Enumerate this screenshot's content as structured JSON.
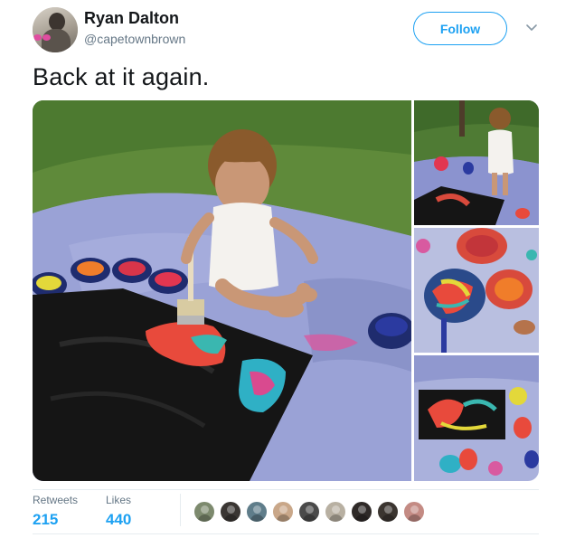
{
  "author": {
    "name": "Ryan Dalton",
    "handle": "@capetownbrown",
    "avatar_icon": "user-avatar"
  },
  "actions": {
    "follow_label": "Follow",
    "more_icon": "chevron-down-icon"
  },
  "tweet": {
    "text": "Back at it again."
  },
  "media": {
    "photo_count": 4,
    "photos": [
      "main-photo",
      "side-photo-1",
      "side-photo-2",
      "side-photo-3"
    ]
  },
  "stats": {
    "retweets_label": "Retweets",
    "retweets_value": "215",
    "likes_label": "Likes",
    "likes_value": "440"
  },
  "likers": {
    "colors": [
      "#7d8a6e",
      "#3a3633",
      "#5f7d8a",
      "#c9a789",
      "#4a4a4a",
      "#b8b0a2",
      "#2f2a28",
      "#3b3530",
      "#c48b84"
    ]
  },
  "colors": {
    "accent": "#1da1f2",
    "text": "#14171a",
    "secondary": "#657786",
    "border": "#e6ecf0"
  }
}
